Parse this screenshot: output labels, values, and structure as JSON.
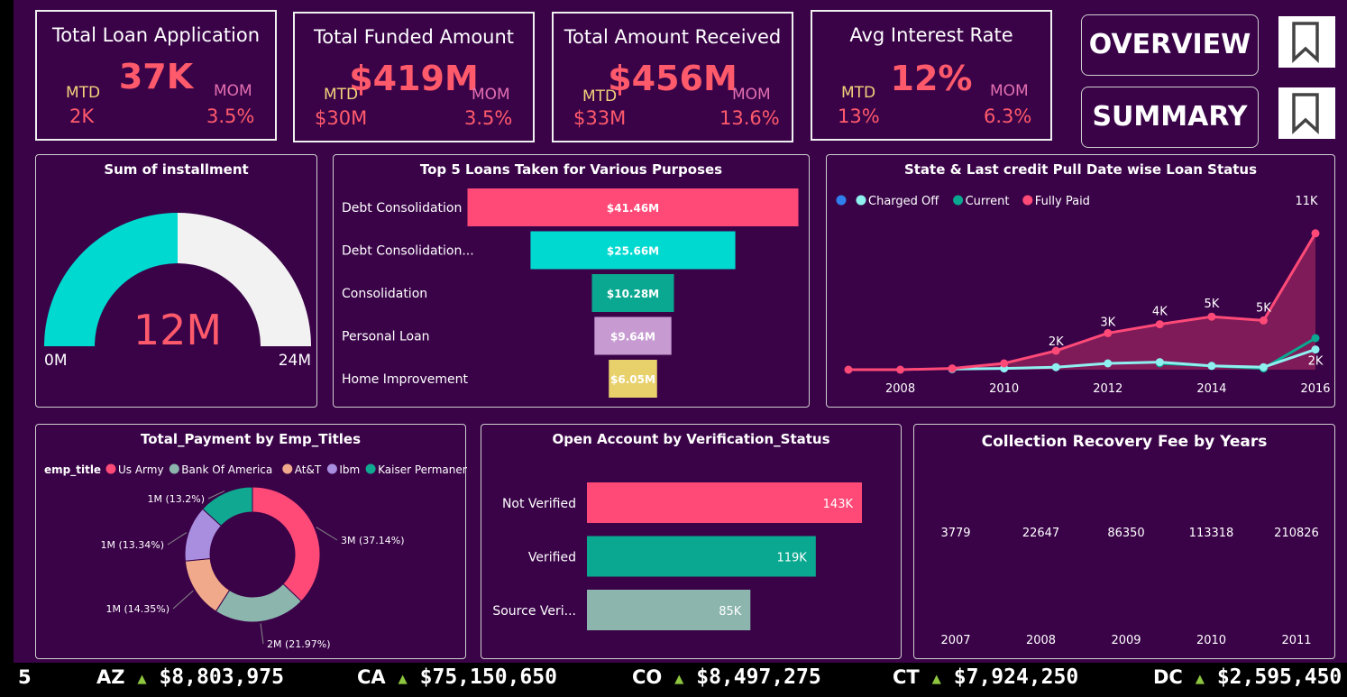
{
  "kpis": [
    {
      "title": "Total Loan Application",
      "value": "37K",
      "mtd_label": "MTD",
      "mtd": "2K",
      "mom_label": "MOM",
      "mom": "3.5%"
    },
    {
      "title": "Total Funded Amount",
      "value": "$419M",
      "mtd_label": "MTD",
      "mtd": "$30M",
      "mom_label": "MOM",
      "mom": "3.5%"
    },
    {
      "title": "Total Amount Received",
      "value": "$456M",
      "mtd_label": "MTD",
      "mtd": "$33M",
      "mom_label": "MOM",
      "mom": "13.6%"
    },
    {
      "title": "Avg Interest Rate",
      "value": "12%",
      "mtd_label": "MTD",
      "mtd": "13%",
      "mom_label": "MOM",
      "mom": "6.3%"
    }
  ],
  "nav": {
    "overview": "OVERVIEW",
    "summary": "SUMMARY"
  },
  "icons": {
    "bookmark": "bookmark-icon",
    "ticker_up": "triangle-up-icon"
  },
  "colors": {
    "background": "#3a0348",
    "accent_pink": "#ff4a78",
    "teal": "#00d9d0",
    "green": "#0aa890",
    "sage": "#8bb5ad",
    "lavender": "#c79bd2",
    "yellow": "#e8d06a",
    "up_arrow": "#8ec63f"
  },
  "chart_data": [
    {
      "type": "gauge",
      "title": "Sum of installment",
      "value": 12,
      "value_label": "12M",
      "min_label": "0M",
      "max_label": "24M",
      "range": [
        0,
        24
      ]
    },
    {
      "type": "bar",
      "title": "Top 5 Loans Taken for Various Purposes",
      "orientation": "horizontal-funnel",
      "categories": [
        "Debt Consolidation",
        "Debt Consolidation...",
        "Consolidation",
        "Personal Loan",
        "Home Improvement"
      ],
      "values": [
        41.46,
        25.66,
        10.28,
        9.64,
        6.05
      ],
      "labels": [
        "$41.46M",
        "$25.66M",
        "$10.28M",
        "$9.64M",
        "$6.05M"
      ],
      "colors": [
        "#ff4a78",
        "#00d9d0",
        "#0aa890",
        "#c79bd2",
        "#e8d06a"
      ]
    },
    {
      "type": "line",
      "title": "State & Last credit Pull Date wise Loan Status",
      "legend": [
        "Charged Off",
        "Current",
        "Fully Paid"
      ],
      "legend_colors": [
        "#8ff0f0",
        "#0aa890",
        "#ff4a78"
      ],
      "x_ticks": [
        "2008",
        "2010",
        "2012",
        "2014",
        "2016"
      ],
      "x": [
        2007,
        2008,
        2009,
        2010,
        2011,
        2012,
        2013,
        2014,
        2015,
        2016
      ],
      "series": [
        {
          "name": "Fully Paid",
          "values": [
            0.0,
            0.0,
            0.1,
            0.5,
            1.5,
            2.9,
            3.6,
            4.2,
            3.9,
            10.8
          ]
        },
        {
          "name": "Charged Off",
          "values": [
            null,
            null,
            0.05,
            0.1,
            0.2,
            0.5,
            0.6,
            0.3,
            0.2,
            1.6
          ]
        },
        {
          "name": "Current",
          "values": [
            null,
            null,
            null,
            null,
            null,
            null,
            0.5,
            0.3,
            0.1,
            2.5
          ]
        }
      ],
      "data_labels": [
        {
          "x": 2011,
          "text": "2K"
        },
        {
          "x": 2012,
          "text": "3K"
        },
        {
          "x": 2013,
          "text": "4K"
        },
        {
          "x": 2014,
          "text": "5K"
        },
        {
          "x": 2015,
          "text": "5K"
        },
        {
          "x": 2016,
          "text": "11K"
        },
        {
          "x": 2016,
          "text": "2K"
        }
      ],
      "ylim": [
        0,
        12
      ]
    },
    {
      "type": "pie",
      "title": "Total_Payment by Emp_Titles",
      "legend_title": "emp_title",
      "categories": [
        "Us Army",
        "Bank Of America",
        "At&T",
        "Ibm",
        "Kaiser Permanente"
      ],
      "values": [
        37.14,
        21.97,
        14.35,
        13.34,
        13.2
      ],
      "labels": [
        "3M (37.14%)",
        "2M (21.97%)",
        "1M (14.35%)",
        "1M (13.34%)",
        "1M (13.2%)"
      ],
      "colors": [
        "#ff4a78",
        "#8bb5ad",
        "#f0a98a",
        "#a98ee0",
        "#10a890"
      ]
    },
    {
      "type": "bar",
      "title": "Open Account by Verification_Status",
      "orientation": "horizontal",
      "categories": [
        "Not Verified",
        "Verified",
        "Source Veri..."
      ],
      "values": [
        143,
        119,
        85
      ],
      "labels": [
        "143K",
        "119K",
        "85K"
      ],
      "colors": [
        "#ff4a78",
        "#0aa890",
        "#8bb5ad"
      ]
    },
    {
      "type": "table",
      "title": "Collection Recovery Fee by Years",
      "categories": [
        "2007",
        "2008",
        "2009",
        "2010",
        "2011"
      ],
      "values": [
        3779,
        22647,
        86350,
        113318,
        210826
      ]
    }
  ],
  "ticker": [
    {
      "code": "5",
      "arrow": "",
      "amount": ""
    },
    {
      "code": "AZ",
      "arrow": "▲",
      "amount": "$8,803,975"
    },
    {
      "code": "CA",
      "arrow": "▲",
      "amount": "$75,150,650"
    },
    {
      "code": "CO",
      "arrow": "▲",
      "amount": "$8,497,275"
    },
    {
      "code": "CT",
      "arrow": "▲",
      "amount": "$7,924,250"
    },
    {
      "code": "DC",
      "arrow": "▲",
      "amount": "$2,595,450"
    }
  ]
}
